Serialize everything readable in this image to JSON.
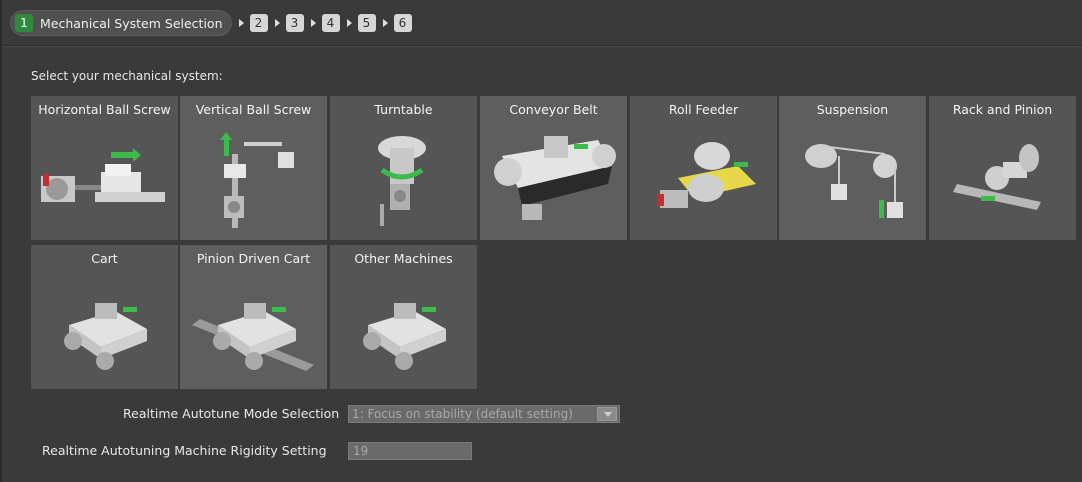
{
  "wizard": {
    "current_step": {
      "number": "1",
      "title": "Mechanical System Selection"
    },
    "steps": [
      "2",
      "3",
      "4",
      "5",
      "6"
    ]
  },
  "prompt": "Select your mechanical system:",
  "systems": [
    {
      "label": "Horizontal Ball Screw",
      "icon": "horizontal-ball-screw-icon"
    },
    {
      "label": "Vertical Ball Screw",
      "icon": "vertical-ball-screw-icon"
    },
    {
      "label": "Turntable",
      "icon": "turntable-icon"
    },
    {
      "label": "Conveyor Belt",
      "icon": "conveyor-belt-icon"
    },
    {
      "label": "Roll Feeder",
      "icon": "roll-feeder-icon"
    },
    {
      "label": "Suspension",
      "icon": "suspension-icon"
    },
    {
      "label": "Rack and Pinion",
      "icon": "rack-and-pinion-icon"
    },
    {
      "label": "Cart",
      "icon": "cart-icon"
    },
    {
      "label": "Pinion Driven Cart",
      "icon": "pinion-driven-cart-icon"
    },
    {
      "label": "Other Machines",
      "icon": "other-machines-icon"
    }
  ],
  "settings": {
    "autotune_mode": {
      "label": "Realtime Autotune Mode Selection",
      "value": "1: Focus on stability (default setting)"
    },
    "rigidity": {
      "label": "Realtime Autotuning Machine Rigidity Setting",
      "value": "19"
    }
  },
  "colors": {
    "step_current": "#2e8b3e",
    "motion_arrow": "#3dbb4a",
    "tile": "#555555",
    "tile_alt": "#5e5e5e"
  }
}
